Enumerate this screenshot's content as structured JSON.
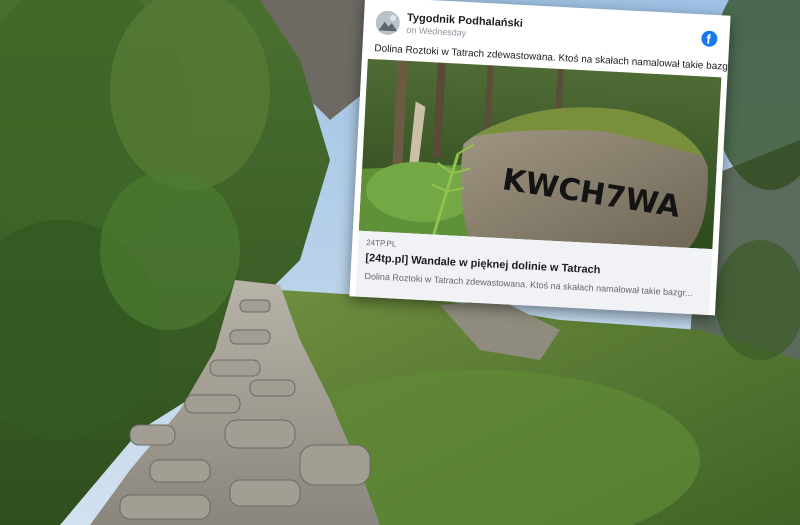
{
  "post": {
    "page_name": "Tygodnik Podhalański",
    "time": "on Wednesday",
    "text": "Dolina Roztoki w Tatrach zdewastowana. Ktoś na skałach namalował takie bazgroły",
    "link": {
      "domain": "24TP.PL",
      "title": "[24tp.pl] Wandale w pięknej dolinie w Tatrach",
      "description": "Dolina Roztoki w Tatrach zdewastowana. Ktoś na skałach namalował takie bazgr..."
    },
    "graffiti": "KWCH7WA"
  },
  "icons": {
    "logo": "facebook-icon",
    "avatar": "page-avatar"
  },
  "colors": {
    "facebook_blue": "#1877f2",
    "link_bg": "#f0f2f5"
  }
}
